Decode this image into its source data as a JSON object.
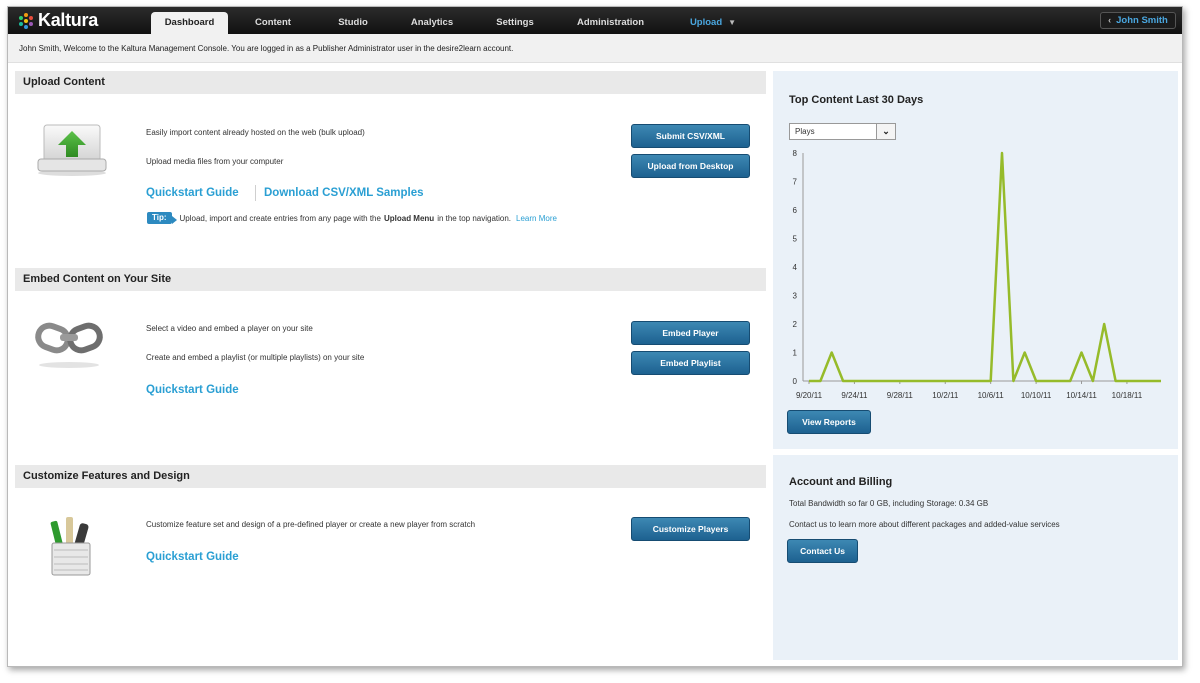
{
  "app": {
    "logo_text": "Kaltura",
    "nav_tabs": [
      "Dashboard",
      "Content",
      "Studio",
      "Analytics",
      "Settings",
      "Administration",
      "Upload"
    ],
    "user_name": "John Smith"
  },
  "welcome_text": "John Smith, Welcome to the Kaltura Management Console. You are logged in as a Publisher Administrator user in the desire2learn account.",
  "upload_section": {
    "title": "Upload Content",
    "line1": "Easily import content already hosted on the web (bulk upload)",
    "line2": "Upload media files from your computer",
    "quickstart": "Quickstart Guide",
    "download_samples": "Download CSV/XML Samples",
    "tip_label": "Tip:",
    "tip_text_before": "Upload, import and create entries from any page with the",
    "tip_text_bold": "Upload Menu",
    "tip_text_after": "in the top navigation.",
    "tip_link": "Learn More",
    "btn_submit": "Submit CSV/XML",
    "btn_desktop": "Upload from Desktop"
  },
  "embed_section": {
    "title": "Embed Content on Your Site",
    "line1": "Select a video and embed a player on your site",
    "line2": "Create and embed a playlist (or multiple playlists) on your site",
    "quickstart": "Quickstart Guide",
    "btn_player": "Embed Player",
    "btn_playlist": "Embed Playlist"
  },
  "customize_section": {
    "title": "Customize Features and Design",
    "line1": "Customize feature set and design of a pre-defined player or create a new player from scratch",
    "quickstart": "Quickstart Guide",
    "btn_customize": "Customize Players"
  },
  "top_content": {
    "title": "Top Content Last 30 Days",
    "select_value": "Plays",
    "btn_reports": "View Reports"
  },
  "billing": {
    "title": "Account and Billing",
    "bandwidth": "Total Bandwidth so far 0 GB, including Storage: 0.34 GB",
    "contact_text": "Contact us to learn more about different packages and added-value services",
    "btn_contact": "Contact Us"
  },
  "colors": {
    "accent": "#2a9fd3",
    "button": "#1d6190",
    "line": "#96bb2a"
  },
  "chart_data": {
    "type": "line",
    "ylim": [
      0,
      8
    ],
    "y_ticks": [
      "0",
      "1",
      "2",
      "3",
      "4",
      "5",
      "6",
      "7",
      "8"
    ],
    "x_ticks": [
      "9/20/11",
      "9/24/11",
      "9/28/11",
      "10/2/11",
      "10/6/11",
      "10/10/11",
      "10/14/11",
      "10/18/11"
    ],
    "series": [
      {
        "values": [
          0,
          0,
          1,
          0,
          0,
          0,
          0,
          0,
          0,
          0,
          0,
          0,
          0,
          0,
          0,
          0,
          0,
          8,
          0,
          1,
          0,
          0,
          0,
          0,
          1,
          0,
          2,
          0,
          0,
          0,
          0,
          0
        ]
      }
    ]
  }
}
